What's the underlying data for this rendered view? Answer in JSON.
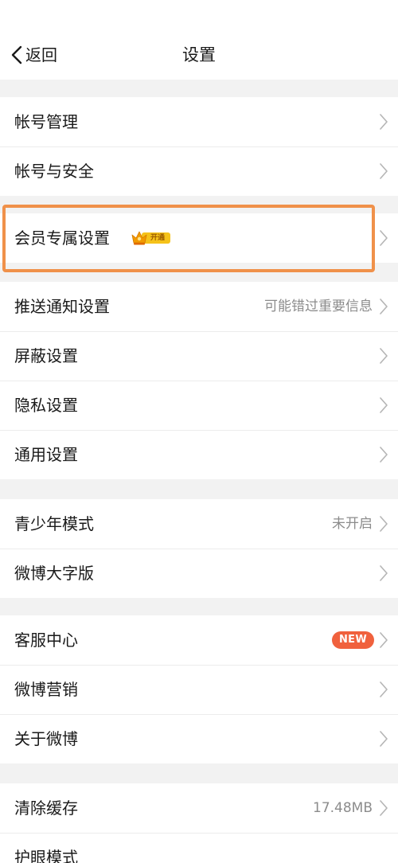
{
  "header": {
    "back_label": "返回",
    "title": "设置"
  },
  "groups": [
    {
      "items": [
        {
          "label": "帐号管理"
        },
        {
          "label": "帐号与安全"
        }
      ]
    },
    {
      "items": [
        {
          "label": "会员专属设置",
          "badge": "开通"
        }
      ]
    },
    {
      "items": [
        {
          "label": "推送通知设置",
          "value": "可能错过重要信息"
        },
        {
          "label": "屏蔽设置"
        },
        {
          "label": "隐私设置"
        },
        {
          "label": "通用设置"
        }
      ]
    },
    {
      "items": [
        {
          "label": "青少年模式",
          "value": "未开启"
        },
        {
          "label": "微博大字版"
        }
      ]
    },
    {
      "items": [
        {
          "label": "客服中心",
          "badge": "NEW"
        },
        {
          "label": "微博营销"
        },
        {
          "label": "关于微博"
        }
      ]
    },
    {
      "items": [
        {
          "label": "清除缓存",
          "value": "17.48MB"
        },
        {
          "label": "护眼模式"
        }
      ]
    }
  ],
  "colors": {
    "background": "#f2f2f2",
    "new_badge": "#f0613d",
    "highlight": "#f0914a",
    "vip_gold": "#f5b800"
  },
  "icons": {
    "back": "chevron-left-icon",
    "row": "chevron-right-icon",
    "vip": "crown-icon"
  }
}
